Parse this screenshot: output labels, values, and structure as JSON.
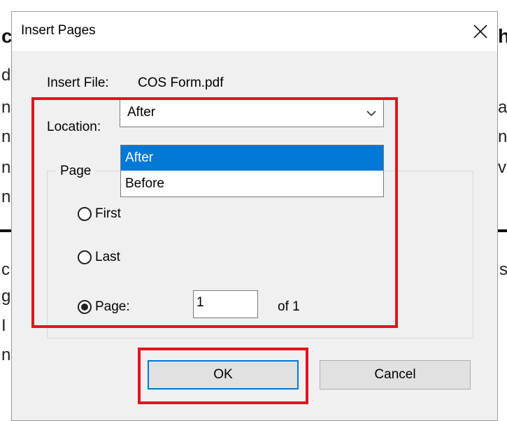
{
  "background_doc": {
    "fragments": [
      "c",
      "d",
      "n",
      "n",
      "n",
      "n",
      "h",
      "a",
      "n",
      "v",
      "c",
      "s",
      "g",
      "I",
      "n"
    ]
  },
  "dialog": {
    "title": "Insert Pages",
    "close_icon": "close-icon",
    "insert_file_label": "Insert File:",
    "insert_file_value": "COS Form.pdf",
    "location_label": "Location:",
    "location_selected": "After",
    "location_options": [
      "After",
      "Before"
    ],
    "page_group_label": "Page",
    "radio_first": "First",
    "radio_last": "Last",
    "radio_page": "Page:",
    "page_number_value": "1",
    "of_total": "of 1",
    "ok_label": "OK",
    "cancel_label": "Cancel",
    "highlight_color": "#e0151f",
    "selection_color": "#0078d7"
  }
}
